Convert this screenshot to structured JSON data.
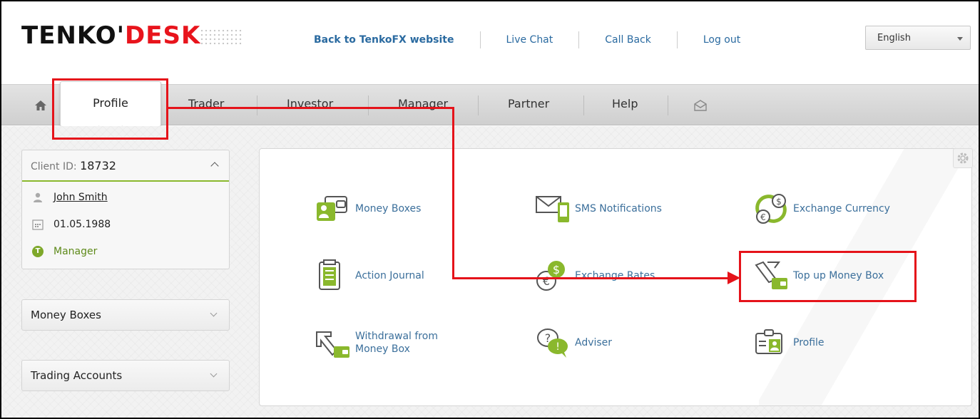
{
  "header": {
    "logo_part1": "TENKO'",
    "logo_part2": "DESK",
    "links": {
      "back": "Back to TenkoFX website",
      "chat": "Live Chat",
      "callback": "Call Back",
      "logout": "Log out"
    },
    "language": "English"
  },
  "nav": {
    "items": {
      "profile": "Profile",
      "trader": "Trader",
      "investor": "Investor",
      "manager": "Manager",
      "partner": "Partner",
      "help": "Help"
    }
  },
  "sidebar": {
    "client_label": "Client ID: ",
    "client_id": "18732",
    "name": "John Smith",
    "dob": "01.05.1988",
    "role": "Manager",
    "money_boxes": "Money Boxes",
    "trading_accounts": "Trading Accounts"
  },
  "tiles": {
    "money_boxes": "Money Boxes",
    "sms": "SMS Notifications",
    "exchange_currency": "Exchange Currency",
    "action_journal": "Action Journal",
    "exchange_rates": "Exchange Rates",
    "top_up": "Top up Money Box",
    "withdrawal_line1": "Withdrawal from",
    "withdrawal_line2": "Money Box",
    "adviser": "Adviser",
    "profile": "Profile"
  },
  "colors": {
    "accent_green": "#7ea82a",
    "link_blue": "#3b6f9b",
    "annotation_red": "#e5131a",
    "logo_red": "#e8141c"
  }
}
